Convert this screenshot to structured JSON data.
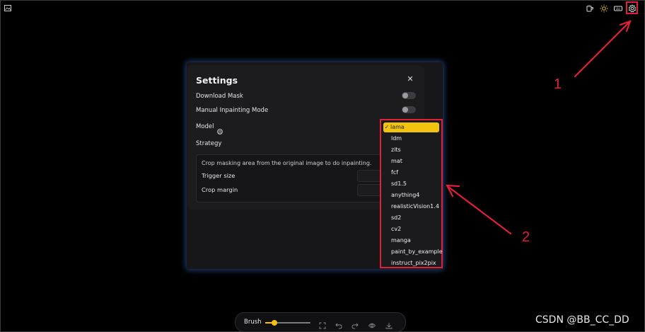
{
  "settings": {
    "title": "Settings",
    "rows": {
      "download_mask": "Download Mask",
      "manual_inpainting": "Manual Inpainting Mode",
      "model": "Model",
      "strategy": "Strategy"
    },
    "strategy_box": {
      "description": "Crop masking area from the original image to do inpainting.",
      "trigger_size": "Trigger size",
      "crop_margin": "Crop margin"
    }
  },
  "model_dropdown": {
    "selected": "lama",
    "options": [
      "lama",
      "ldm",
      "zits",
      "mat",
      "fcf",
      "sd1.5",
      "anything4",
      "realisticVision1.4",
      "sd2",
      "cv2",
      "manga",
      "paint_by_example",
      "instruct_pix2pix"
    ]
  },
  "annotations": {
    "one": "1",
    "two": "2"
  },
  "toolbar": {
    "brush_label": "Brush",
    "brush_size": 0.2
  },
  "watermark": "CSDN @BB_CC_DD",
  "colors": {
    "accent": "#f2c40f",
    "annotation": "#e0203a"
  }
}
